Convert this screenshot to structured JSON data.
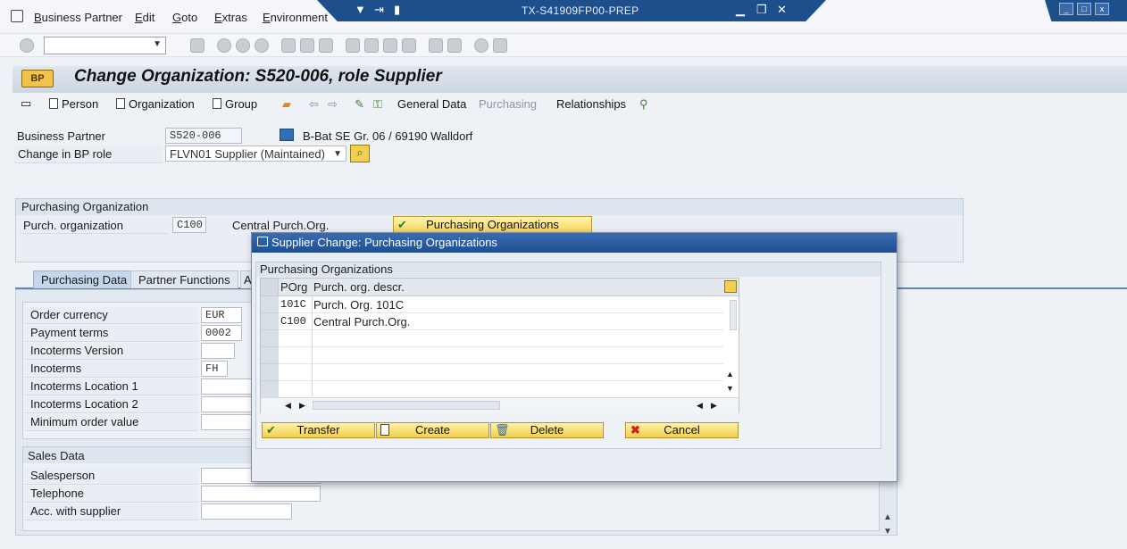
{
  "menu": [
    "Business Partner",
    "Edit",
    "Goto",
    "Extras",
    "Environment"
  ],
  "window": {
    "title": "TX-S41909FP00-PREP"
  },
  "header": {
    "title": "Change Organization: S520-006, role Supplier"
  },
  "app_toolbar": {
    "person": "Person",
    "organization": "Organization",
    "group": "Group",
    "general_data": "General Data",
    "purchasing": "Purchasing",
    "relationships": "Relationships"
  },
  "bp": {
    "label": "Business Partner",
    "value": "S520-006",
    "address": "B-Bat SE Gr. 06 / 69190 Walldorf",
    "role_label": "Change in BP role",
    "role_value": "FLVN01 Supplier (Maintained)"
  },
  "purch_org": {
    "section": "Purchasing Organization",
    "label": "Purch. organization",
    "value": "C100",
    "desc": "Central Purch.Org.",
    "button": "Purchasing Organizations"
  },
  "tabs": [
    "Purchasing Data",
    "Partner Functions",
    "A"
  ],
  "purchasing_data": {
    "fields": [
      {
        "label": "Order currency",
        "value": "EUR"
      },
      {
        "label": "Payment terms",
        "value": "0002"
      },
      {
        "label": "Incoterms Version",
        "value": ""
      },
      {
        "label": "Incoterms",
        "value": "FH"
      },
      {
        "label": "Incoterms Location 1",
        "value": ""
      },
      {
        "label": "Incoterms Location 2",
        "value": ""
      },
      {
        "label": "Minimum order value",
        "value": ""
      }
    ]
  },
  "sales_data": {
    "section": "Sales Data",
    "fields": [
      {
        "label": "Salesperson",
        "value": ""
      },
      {
        "label": "Telephone",
        "value": ""
      },
      {
        "label": "Acc. with supplier",
        "value": ""
      }
    ]
  },
  "dialog": {
    "title": "Supplier Change: Purchasing Organizations",
    "section": "Purchasing Organizations",
    "columns": [
      "POrg",
      "Purch. org. descr."
    ],
    "rows": [
      {
        "porg": "101C",
        "descr": "Purch. Org. 101C"
      },
      {
        "porg": "C100",
        "descr": "Central Purch.Org."
      }
    ],
    "buttons": {
      "transfer": "Transfer",
      "create": "Create",
      "delete": "Delete",
      "cancel": "Cancel"
    }
  },
  "colors": {
    "title_bar": "#1d4f8c",
    "button_yellow": "#f5d35a",
    "header_bg": "#dfe6ee"
  }
}
